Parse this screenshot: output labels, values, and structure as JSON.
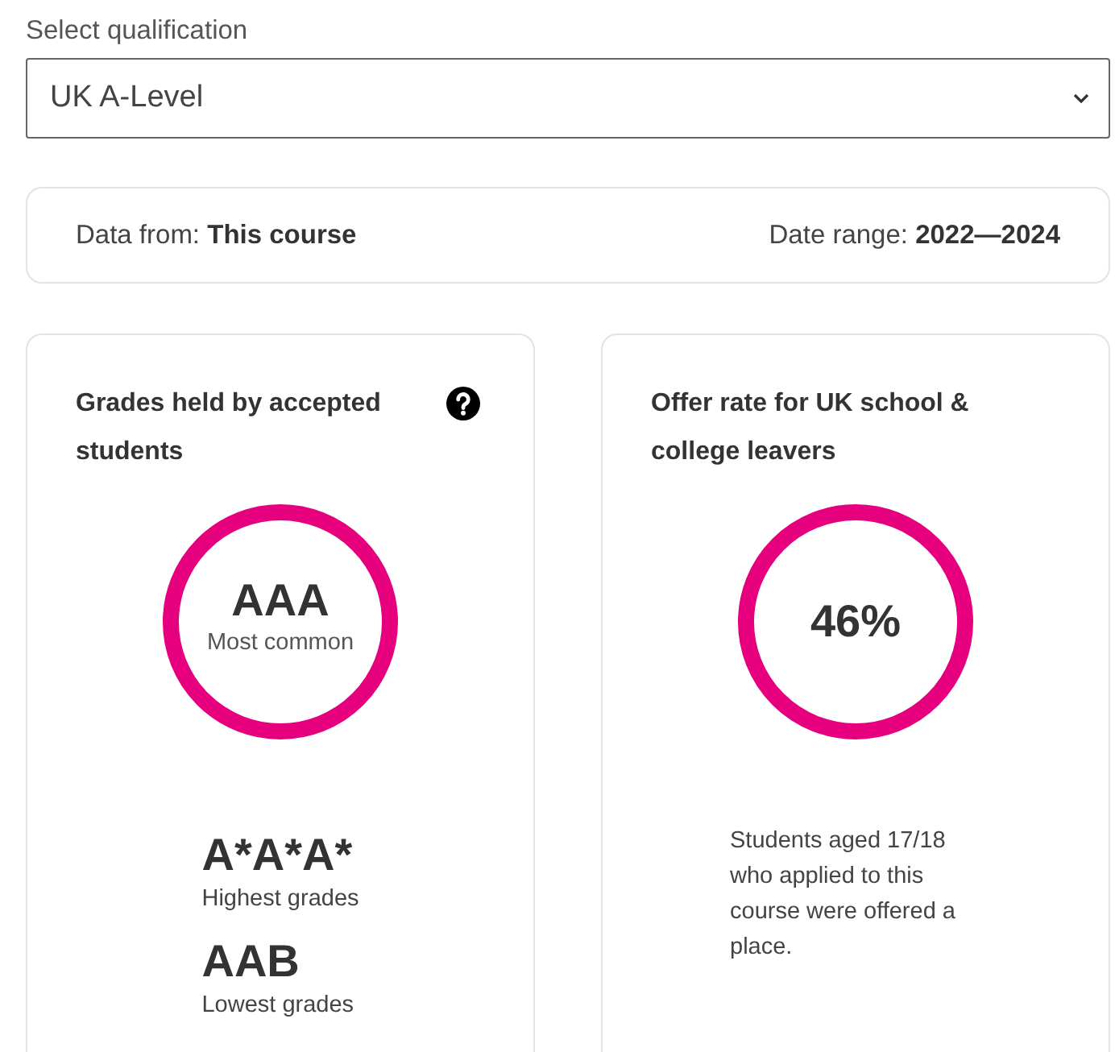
{
  "qualification_select": {
    "label": "Select qualification",
    "value": "UK A-Level"
  },
  "data_source": {
    "from_label": "Data from:",
    "from_value": "This course",
    "range_label": "Date range:",
    "range_value": "2022—2024"
  },
  "cards": [
    {
      "kind": "grades",
      "title": "Grades held by accepted students",
      "help": true,
      "headline": {
        "value": "AAA",
        "caption": "Most common"
      },
      "stats": [
        {
          "value": "A*A*A*",
          "caption": "Highest grades"
        },
        {
          "value": "AAB",
          "caption": "Lowest grades"
        }
      ]
    },
    {
      "kind": "rate",
      "title": "Offer rate for UK school & college leavers",
      "help": false,
      "headline": {
        "value": "46%"
      },
      "note": "Students aged 17/18 who applied to this course were offered a place."
    }
  ]
}
